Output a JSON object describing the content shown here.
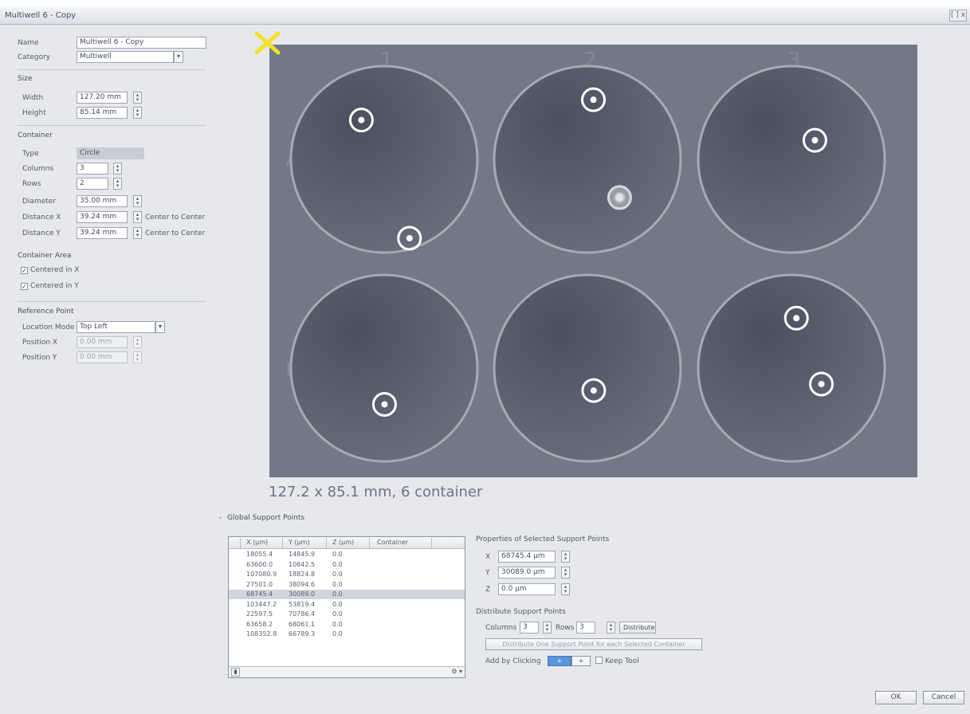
{
  "window": {
    "title": "Multiwell 6 - Copy",
    "close_label": "[ ] x"
  },
  "general": {
    "name_label": "Name",
    "name_value": "Multiwell 6 - Copy",
    "category_label": "Category",
    "category_value": "Multiwell"
  },
  "size": {
    "title": "Size",
    "width_label": "Width",
    "width_value": "127.20 mm",
    "height_label": "Height",
    "height_value": "85.14 mm"
  },
  "container": {
    "title": "Container",
    "type_label": "Type",
    "type_value": "Circle",
    "columns_label": "Columns",
    "columns_value": "3",
    "rows_label": "Rows",
    "rows_value": "2",
    "diameter_label": "Diameter",
    "diameter_value": "35.00 mm",
    "distance_x_label": "Distance X",
    "distance_x_value": "39.24 mm",
    "distance_x_mode": "Center to Center",
    "distance_y_label": "Distance Y",
    "distance_y_value": "39.24 mm",
    "distance_y_mode": "Center to Center"
  },
  "container_area": {
    "title": "Container Area",
    "centered_x": "Centered in X",
    "centered_y": "Centered in Y"
  },
  "reference_point": {
    "title": "Reference Point",
    "location_mode_label": "Location Mode",
    "location_mode_value": "Top Left",
    "position_x_label": "Position X",
    "position_x_value": "0.00 mm",
    "position_y_label": "Position Y",
    "position_y_value": "0.00 mm"
  },
  "plate": {
    "column_labels": [
      "1",
      "2",
      "3"
    ],
    "row_labels": [
      "A",
      "B"
    ],
    "summary": "127.2 x 85.1 mm, 6 container",
    "colors": {
      "plate": "#737886",
      "well_fill": "#4f5463",
      "well_ring": "#a7aab3",
      "marker": "#ffffff",
      "origin_marker": "#f3e12a"
    }
  },
  "global_support_points": {
    "title": "Global Support Points",
    "toggle": "-",
    "columns": [
      "X (µm)",
      "Y (µm)",
      "Z (µm)",
      "Container"
    ],
    "rows": [
      [
        "18055.4",
        "14845.9",
        "0.0",
        ""
      ],
      [
        "63600.0",
        "10842.5",
        "0.0",
        ""
      ],
      [
        "107080.9",
        "18824.8",
        "0.0",
        ""
      ],
      [
        "27501.0",
        "38094.6",
        "0.0",
        ""
      ],
      [
        "68745.4",
        "30089.0",
        "0.0",
        ""
      ],
      [
        "103447.2",
        "53819.4",
        "0.0",
        ""
      ],
      [
        "22597.5",
        "70786.4",
        "0.0",
        ""
      ],
      [
        "63658.2",
        "68061.1",
        "0.0",
        ""
      ],
      [
        "108352.8",
        "66789.3",
        "0.0",
        ""
      ]
    ],
    "selected_row": 4,
    "footer_right": "⚙ ▾"
  },
  "properties": {
    "title": "Properties of Selected Support Points",
    "x_label": "X",
    "x_value": "68745.4 µm",
    "y_label": "Y",
    "y_value": "30089.0 µm",
    "z_label": "Z",
    "z_value": "0.0 µm"
  },
  "distribute": {
    "title": "Distribute Support Points",
    "columns_label": "Columns",
    "columns_value": "3",
    "rows_label": "Rows",
    "rows_value": "3",
    "distribute_button": "Distribute",
    "one_per_container_button": "Distribute One Support Point for each Selected Container",
    "add_by_clicking_label": "Add by Clicking",
    "add_on": "+",
    "add_off": "+",
    "keep_tool_label": "Keep Tool"
  },
  "dialog": {
    "ok_label": "OK",
    "cancel_label": "Cancel"
  }
}
